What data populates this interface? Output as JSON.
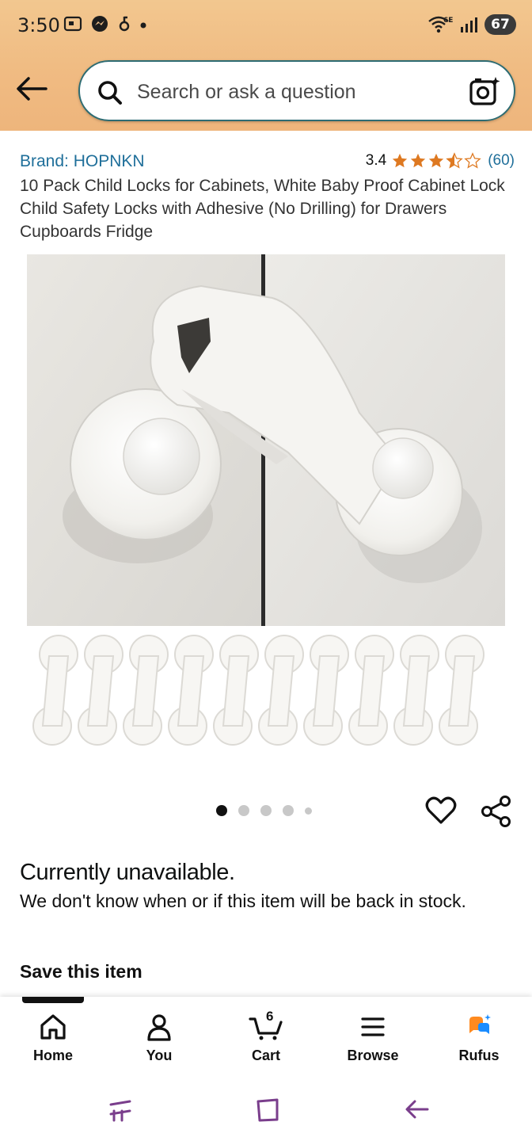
{
  "status_bar": {
    "time": "3:50",
    "battery": "67",
    "network": "6E"
  },
  "search": {
    "placeholder": "Search or ask a question"
  },
  "product": {
    "brand": "Brand: HOPNKN",
    "rating": "3.4",
    "stars_filled": 3.5,
    "review_count": "(60)",
    "title": "10 Pack Child Locks for Cabinets, White Baby Proof Cabinet Lock Child Safety Locks with Adhesive (No Drilling) for Drawers Cupboards Fridge"
  },
  "carousel": {
    "total_dots": 5,
    "active_index": 0
  },
  "availability": {
    "heading": "Currently unavailable.",
    "message": "We don't know when or if this item will be back in stock."
  },
  "save_section": {
    "label": "Save this item"
  },
  "bottom_nav": {
    "items": [
      {
        "label": "Home",
        "icon": "home-icon"
      },
      {
        "label": "You",
        "icon": "person-icon"
      },
      {
        "label": "Cart",
        "icon": "cart-icon",
        "badge": "6"
      },
      {
        "label": "Browse",
        "icon": "menu-icon"
      },
      {
        "label": "Rufus",
        "icon": "rufus-icon"
      }
    ]
  },
  "colors": {
    "header_bg": "#f0bb82",
    "link": "#1f6f9a",
    "star": "#de7921",
    "rufus_accent": "#ff8a1f",
    "rufus_blue": "#1a8cff",
    "system_nav": "#7a3e8c"
  }
}
